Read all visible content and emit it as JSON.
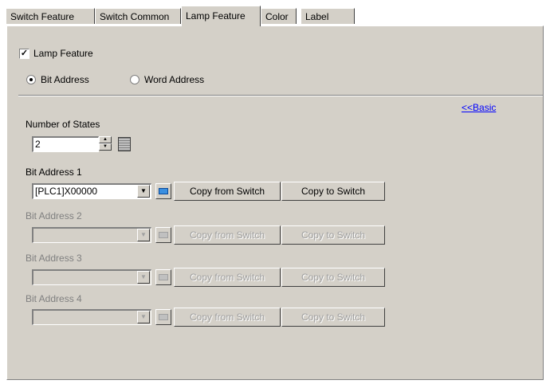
{
  "tabs": [
    {
      "label": "Switch Feature",
      "active": false
    },
    {
      "label": "Switch Common",
      "active": false
    },
    {
      "label": "Lamp Feature",
      "active": true
    },
    {
      "label": "Color",
      "active": false
    },
    {
      "label": "Label",
      "active": false
    }
  ],
  "lamp_feature": {
    "label": "Lamp Feature",
    "checked": true
  },
  "address_type": {
    "bit_label": "Bit Address",
    "word_label": "Word Address",
    "selected": "bit"
  },
  "basic_link": "<<Basic",
  "number_of_states": {
    "label": "Number of States",
    "value": "2"
  },
  "bit_addresses": [
    {
      "label": "Bit Address 1",
      "value": "[PLC1]X00000",
      "enabled": true
    },
    {
      "label": "Bit Address 2",
      "value": "",
      "enabled": false
    },
    {
      "label": "Bit Address 3",
      "value": "",
      "enabled": false
    },
    {
      "label": "Bit Address 4",
      "value": "",
      "enabled": false
    }
  ],
  "buttons": {
    "copy_from": "Copy from Switch",
    "copy_to": "Copy to Switch"
  }
}
